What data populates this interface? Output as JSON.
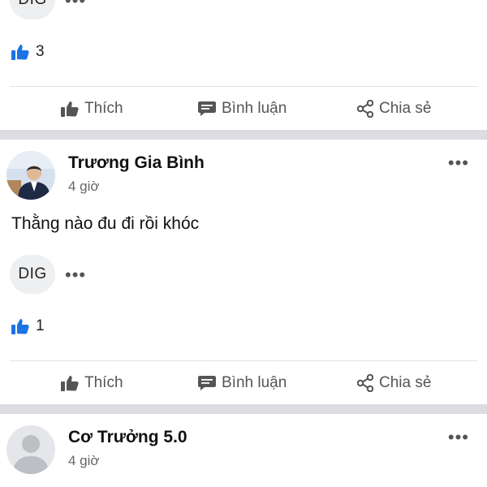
{
  "post1": {
    "chip_label": "DIG",
    "chip_more": "•••",
    "like_count": "3",
    "actions": {
      "like": "Thích",
      "comment": "Bình luận",
      "share": "Chia sẻ"
    }
  },
  "post2": {
    "author": "Trương Gia Bình",
    "time": "4 giờ",
    "more": "•••",
    "text": "Thằng nào đu đi rồi khóc",
    "chip_label": "DIG",
    "chip_more": "•••",
    "like_count": "1",
    "actions": {
      "like": "Thích",
      "comment": "Bình luận",
      "share": "Chia sẻ"
    }
  },
  "post3": {
    "author": "Cơ Trưởng 5.0",
    "time": "4 giờ",
    "more": "•••"
  },
  "colors": {
    "like_blue": "#1b74e4",
    "separator": "#dcdde0",
    "action_gray": "#555555"
  }
}
